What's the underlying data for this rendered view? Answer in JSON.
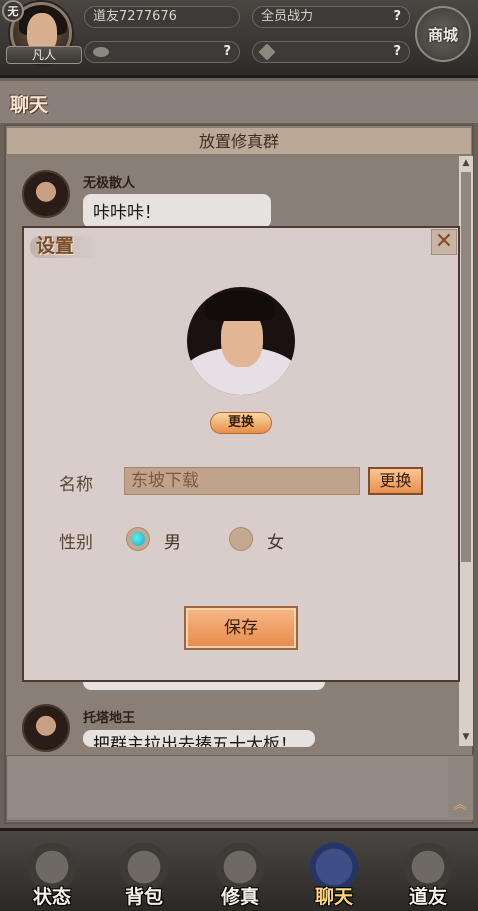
{
  "header": {
    "vip_badge": "无",
    "rank": "凡人",
    "player_id": "道友7277676",
    "power_label": "全员战力",
    "power_help": "?",
    "currency1_help": "?",
    "currency2_help": "?",
    "shop_label": "商城"
  },
  "chat": {
    "title": "聊天",
    "group_name": "放置修真群",
    "messages": [
      {
        "name": "无极散人",
        "text": "咔咔咔！"
      },
      {
        "name": "托塔地王",
        "text": "把群主拉出去揍五十大板！"
      }
    ]
  },
  "settings_dialog": {
    "title": "设置",
    "close_symbol": "✕",
    "avatar_change_label": "更换",
    "name_label": "名称",
    "name_value": "东坡下载",
    "name_change_label": "更换",
    "gender_label": "性别",
    "gender_options": [
      "男",
      "女"
    ],
    "gender_selected": "男",
    "save_label": "保存"
  },
  "bottom_nav": [
    {
      "label": "状态",
      "icon": "status-icon"
    },
    {
      "label": "背包",
      "icon": "bag-icon"
    },
    {
      "label": "修真",
      "icon": "cultivation-icon"
    },
    {
      "label": "聊天",
      "icon": "chat-icon",
      "active": true
    },
    {
      "label": "道友",
      "icon": "friends-icon"
    }
  ],
  "colors": {
    "accent_orange": "#e78a4a",
    "dialog_bg": "#d8cdcb",
    "radio_selected": "#19a9c4",
    "active_nav": "#ffd77a"
  }
}
